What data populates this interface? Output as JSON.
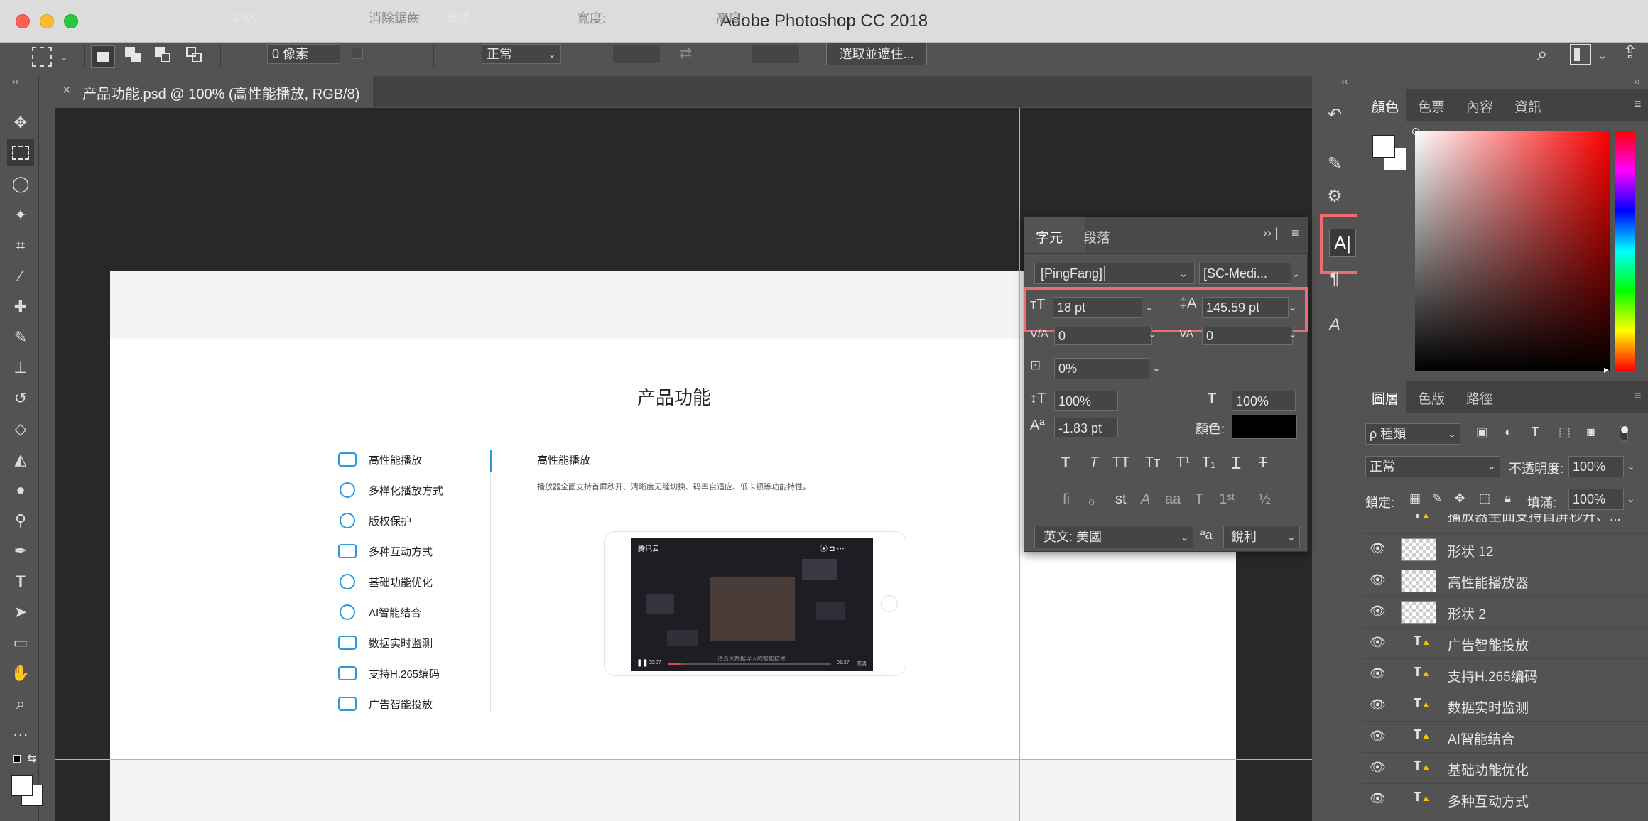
{
  "window": {
    "title": "Adobe Photoshop CC 2018"
  },
  "options_bar": {
    "feather_label": "羽化:",
    "feather_value": "0 像素",
    "antialias_label": "消除鋸齒",
    "style_label": "樣式:",
    "style_value": "正常",
    "width_label": "寬度:",
    "height_label": "高度:",
    "select_mask_button": "選取並遮住..."
  },
  "document_tab": {
    "label": "产品功能.psd @ 100% (高性能播放, RGB/8)",
    "close": "×"
  },
  "artboard": {
    "title": "产品功能",
    "features": [
      "高性能播放",
      "多样化播放方式",
      "版权保护",
      "多种互动方式",
      "基础功能优化",
      "AI智能结合",
      "数据实时监测",
      "支持H.265编码",
      "广告智能投放"
    ],
    "detail_title": "高性能播放",
    "detail_desc": "播放器全面支持首屏秒开、清晰度无缝切换、码率自适应、低卡顿等功能特性。",
    "player": {
      "back_label": "腾讯云",
      "subtitle": "适合大数据导入的智能技术",
      "time_start": "00:07",
      "time_end": "01:27",
      "quality": "高清"
    }
  },
  "character_panel": {
    "tabs": [
      "字元",
      "段落"
    ],
    "font_family": "[PingFang]",
    "font_style": "[SC-Medi...",
    "font_size": "18 pt",
    "leading": "145.59 pt",
    "kerning": "0",
    "tracking": "0",
    "tsume": "0%",
    "vertical_scale": "100%",
    "horizontal_scale": "100%",
    "baseline_shift": "-1.83 pt",
    "color_label": "顏色:",
    "color_value": "#000000",
    "language": "英文: 美國",
    "antialias_symbol": "ªa",
    "antialias": "銳利"
  },
  "color_panel": {
    "tabs": [
      "顏色",
      "色票",
      "內容",
      "資訊"
    ]
  },
  "layers_panel": {
    "tabs": [
      "圖層",
      "色版",
      "路徑"
    ],
    "filter_kind": "ρ 種類",
    "blend_mode": "正常",
    "opacity_label": "不透明度:",
    "opacity_value": "100%",
    "lock_label": "鎖定:",
    "fill_label": "填滿:",
    "fill_value": "100%",
    "partial_top_layer": "播放器全面支持首屏秒开、...",
    "layers": [
      {
        "name": "形状 12",
        "kind": "shape"
      },
      {
        "name": "高性能播放器",
        "kind": "smart"
      },
      {
        "name": "形状 2",
        "kind": "shape"
      },
      {
        "name": "广告智能投放",
        "kind": "text"
      },
      {
        "name": "支持H.265编码",
        "kind": "text"
      },
      {
        "name": "数据实时监测",
        "kind": "text"
      },
      {
        "name": "AI智能结合",
        "kind": "text"
      },
      {
        "name": "基础功能优化",
        "kind": "text"
      },
      {
        "name": "多种互动方式",
        "kind": "text"
      }
    ]
  },
  "colors": {
    "guide": "#44e1e7",
    "highlight": "#f06a72",
    "accent_blue": "#2b9be0"
  }
}
